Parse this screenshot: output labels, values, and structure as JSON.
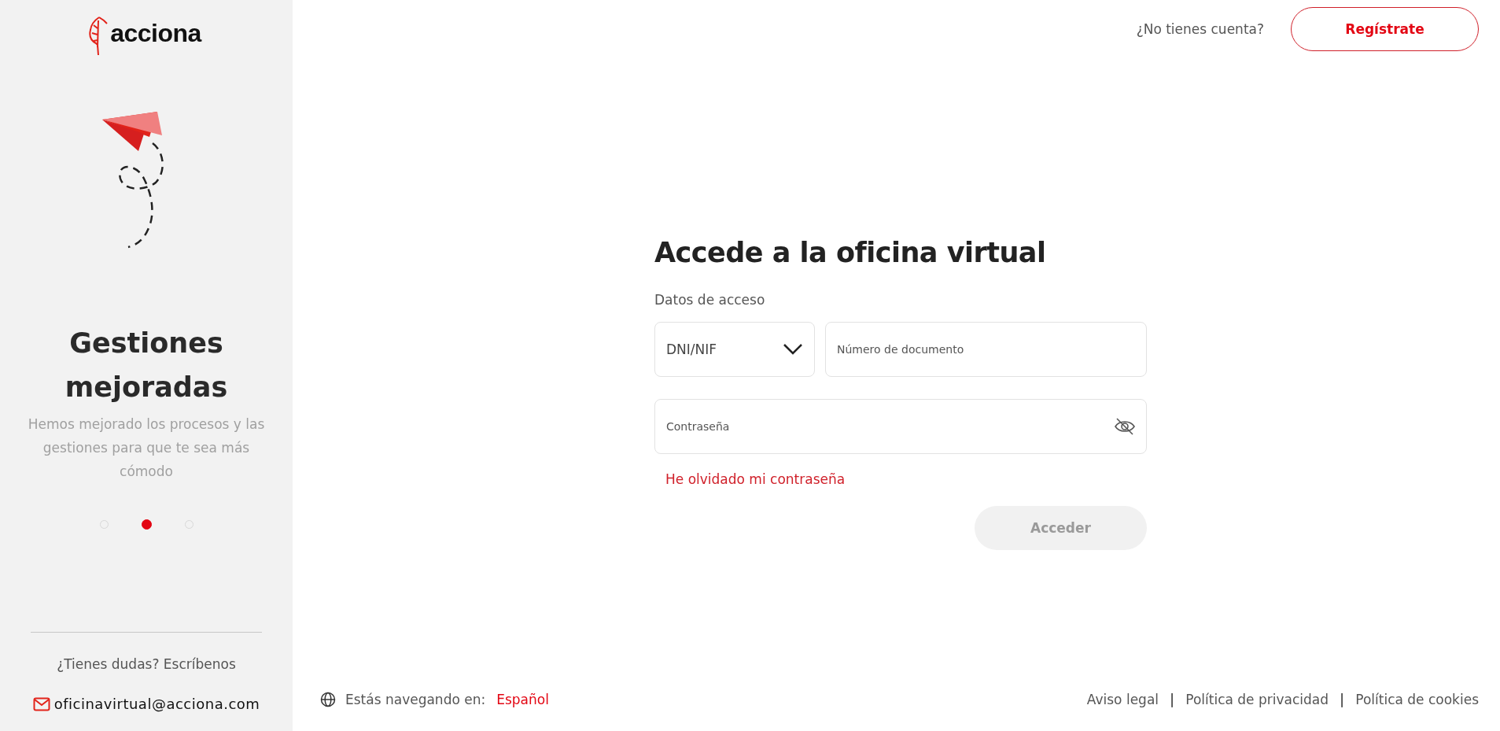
{
  "sidebar": {
    "logo_text": "acciona",
    "slide": {
      "title": "Gestiones mejoradas",
      "text": "Hemos mejorado los procesos y las gestiones para que te sea más cómodo"
    },
    "carousel_dots": [
      {
        "selected": false
      },
      {
        "selected": true
      },
      {
        "selected": false
      }
    ],
    "help": "¿Tienes dudas? Escríbenos",
    "email": "oficinavirtual@acciona.com"
  },
  "header": {
    "question": "¿No tienes cuenta?",
    "register_button": "Regístrate"
  },
  "form": {
    "title": "Accede a la oficina virtual",
    "section_label": "Datos de acceso",
    "document_type": "DNI/NIF",
    "document_number": {
      "placeholder": "Número de documento"
    },
    "password": {
      "placeholder": "Contraseña"
    },
    "forgot_link": "He olvidado mi contraseña",
    "submit": {
      "label": "Acceder",
      "disabled": true
    }
  },
  "footer": {
    "language_label": "Estás navegando en:",
    "language": "Español",
    "links": [
      "Aviso legal",
      "Política de privacidad",
      "Política de cookies"
    ],
    "separator": "|"
  }
}
